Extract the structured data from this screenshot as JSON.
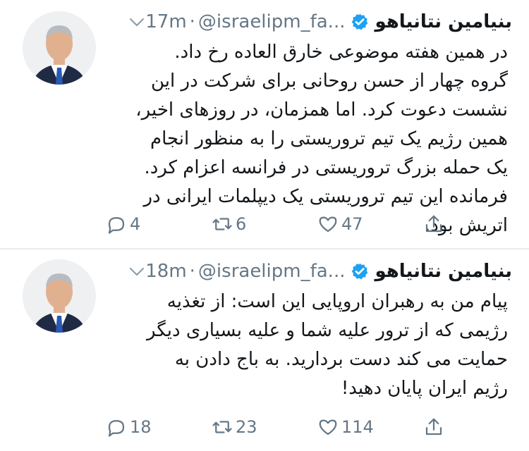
{
  "tweets": [
    {
      "name": "بنیامین نتانیاهو",
      "handle": "@israelipm_fa...",
      "separator": "·",
      "time": "17m",
      "text": "در همین هفته موضوعی خارق العاده رخ داد. گروه چهار از حسن روحانی برای شرکت در این نشست دعوت کرد. اما همزمان، در روزهای اخیر، همین رژیم یک تیم تروریستی را به منظور انجام یک حمله بزرگ تروریستی در فرانسه اعزام کرد. فرمانده این تیم تروریستی یک دیپلمات ایرانی در اتریش بود.",
      "replies": "4",
      "retweets": "6",
      "likes": "47"
    },
    {
      "name": "بنیامین نتانیاهو",
      "handle": "@israelipm_fa...",
      "separator": "·",
      "time": "18m",
      "text": "پیام من به رهبران اروپایی این است: از تغذیه رژیمی که از ترور علیه شما و علیه بسیاری دیگر حمایت می کند دست بردارید. به باج دادن به رژیم ایران پایان دهید!",
      "replies": "18",
      "retweets": "23",
      "likes": "114"
    }
  ],
  "icons": {
    "verified": "verified-badge-icon",
    "more": "chevron-down-icon",
    "reply": "reply-icon",
    "retweet": "retweet-icon",
    "like": "heart-icon",
    "share": "share-icon"
  },
  "colors": {
    "verified": "#1da1f2",
    "muted": "#657786",
    "divider": "#e6ecf0"
  }
}
